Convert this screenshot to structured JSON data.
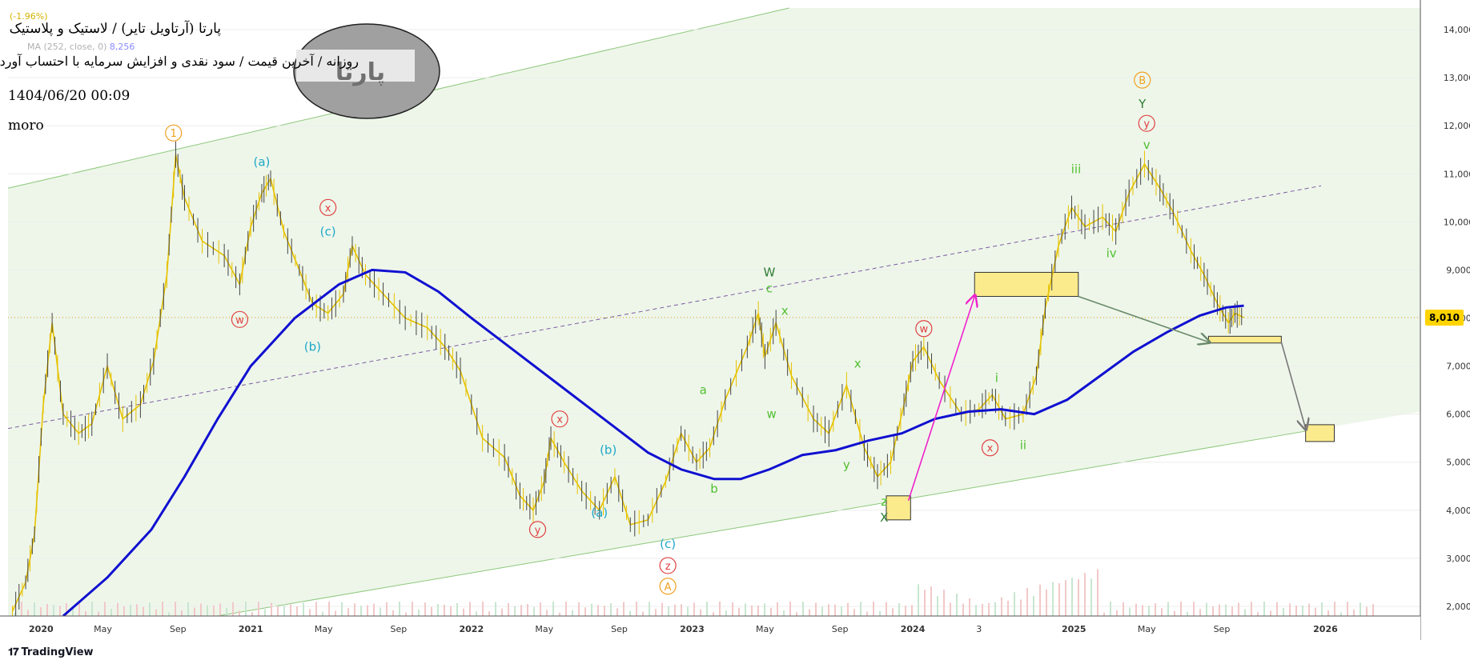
{
  "header": {
    "title": "پارتا (آرتاویل تایر) / لاستیک و پلاستیک",
    "subtitle": "روزانه / آخرین قیمت / سود نقدی و افزایش سرمایه با احتساب آورده",
    "timestamp": "1404/06/20 00:09",
    "author": "moro",
    "legend_change": "(-1.96%)",
    "ma_label": "MA (252, close, 0)",
    "ma_value": "8,256",
    "watermark": "پارتا"
  },
  "footer": {
    "brand": "TradingView"
  },
  "chart_data": {
    "type": "line",
    "x_tick_labels": [
      "2020",
      "May",
      "Sep",
      "2021",
      "May",
      "Sep",
      "2022",
      "May",
      "Sep",
      "2023",
      "May",
      "Sep",
      "2024",
      "3",
      "2025",
      "May",
      "Sep",
      "2026"
    ],
    "y_ticks": [
      "2,000",
      "3,000",
      "4,000",
      "5,000",
      "6,000",
      "7,000",
      "8,000",
      "9,000",
      "10,000",
      "11,000",
      "12,000",
      "13,000",
      "14,000"
    ],
    "ylim": [
      1800,
      14450
    ],
    "last_price": 8010,
    "last_price_label": "8,010",
    "colors": {
      "price": "#e6c200",
      "ma": "#1010d0",
      "channel": "#8cc87a",
      "midline": "#7a5aa0",
      "wave_orange": "#f0a020",
      "wave_red": "#e04040",
      "wave_cyan": "#20a8c8",
      "wave_green": "#50c030",
      "wave_dark": "#2e7d32",
      "arrow_magenta": "#ee22cc"
    },
    "series": [
      {
        "type": "price",
        "points": [
          [
            2019.92,
            1900
          ],
          [
            2019.98,
            2500
          ],
          [
            2020.02,
            3500
          ],
          [
            2020.06,
            6200
          ],
          [
            2020.1,
            7900
          ],
          [
            2020.15,
            6000
          ],
          [
            2020.22,
            5600
          ],
          [
            2020.28,
            5800
          ],
          [
            2020.35,
            7000
          ],
          [
            2020.42,
            5900
          ],
          [
            2020.5,
            6200
          ],
          [
            2020.56,
            7100
          ],
          [
            2020.62,
            8900
          ],
          [
            2020.66,
            11400
          ],
          [
            2020.7,
            10500
          ],
          [
            2020.78,
            9600
          ],
          [
            2020.88,
            9300
          ],
          [
            2020.95,
            8700
          ],
          [
            2021.0,
            9900
          ],
          [
            2021.05,
            10600
          ],
          [
            2021.09,
            10900
          ],
          [
            2021.15,
            9800
          ],
          [
            2021.22,
            9000
          ],
          [
            2021.28,
            8300
          ],
          [
            2021.35,
            8100
          ],
          [
            2021.42,
            8500
          ],
          [
            2021.46,
            9500
          ],
          [
            2021.52,
            8900
          ],
          [
            2021.6,
            8500
          ],
          [
            2021.7,
            8000
          ],
          [
            2021.8,
            7800
          ],
          [
            2021.88,
            7400
          ],
          [
            2021.95,
            6900
          ],
          [
            2022.05,
            5500
          ],
          [
            2022.15,
            5100
          ],
          [
            2022.22,
            4300
          ],
          [
            2022.28,
            4000
          ],
          [
            2022.33,
            4600
          ],
          [
            2022.36,
            5500
          ],
          [
            2022.42,
            5000
          ],
          [
            2022.5,
            4400
          ],
          [
            2022.58,
            4000
          ],
          [
            2022.65,
            4700
          ],
          [
            2022.72,
            3700
          ],
          [
            2022.8,
            3800
          ],
          [
            2022.88,
            4600
          ],
          [
            2022.95,
            5600
          ],
          [
            2023.02,
            5000
          ],
          [
            2023.08,
            5300
          ],
          [
            2023.15,
            6300
          ],
          [
            2023.25,
            7400
          ],
          [
            2023.3,
            8100
          ],
          [
            2023.33,
            7200
          ],
          [
            2023.38,
            7900
          ],
          [
            2023.45,
            6800
          ],
          [
            2023.55,
            5900
          ],
          [
            2023.62,
            5600
          ],
          [
            2023.7,
            6600
          ],
          [
            2023.78,
            5300
          ],
          [
            2023.84,
            4700
          ],
          [
            2023.9,
            5000
          ],
          [
            2023.96,
            6200
          ],
          [
            2024.0,
            7100
          ],
          [
            2024.05,
            7400
          ],
          [
            2024.12,
            6700
          ],
          [
            2024.22,
            6000
          ],
          [
            2024.3,
            6100
          ],
          [
            2024.36,
            6400
          ],
          [
            2024.42,
            5900
          ],
          [
            2024.5,
            6000
          ],
          [
            2024.56,
            6800
          ],
          [
            2024.6,
            8200
          ],
          [
            2024.66,
            9500
          ],
          [
            2024.72,
            10300
          ],
          [
            2024.78,
            9900
          ],
          [
            2024.86,
            10100
          ],
          [
            2024.92,
            9800
          ],
          [
            2024.98,
            10600
          ],
          [
            2025.05,
            11200
          ],
          [
            2025.12,
            10700
          ],
          [
            2025.18,
            10200
          ],
          [
            2025.26,
            9400
          ],
          [
            2025.32,
            8900
          ],
          [
            2025.38,
            8300
          ],
          [
            2025.43,
            7900
          ],
          [
            2025.46,
            8100
          ],
          [
            2025.5,
            8010
          ]
        ]
      },
      {
        "type": "ma",
        "name": "MA (252, close, 0)",
        "points": [
          [
            2020.15,
            1800
          ],
          [
            2020.35,
            2600
          ],
          [
            2020.55,
            3600
          ],
          [
            2020.7,
            4700
          ],
          [
            2020.85,
            5900
          ],
          [
            2021.0,
            7000
          ],
          [
            2021.2,
            8000
          ],
          [
            2021.4,
            8700
          ],
          [
            2021.55,
            9000
          ],
          [
            2021.7,
            8950
          ],
          [
            2021.85,
            8550
          ],
          [
            2022.0,
            8000
          ],
          [
            2022.2,
            7300
          ],
          [
            2022.4,
            6600
          ],
          [
            2022.6,
            5900
          ],
          [
            2022.8,
            5200
          ],
          [
            2022.95,
            4850
          ],
          [
            2023.1,
            4650
          ],
          [
            2023.22,
            4650
          ],
          [
            2023.35,
            4850
          ],
          [
            2023.5,
            5150
          ],
          [
            2023.65,
            5250
          ],
          [
            2023.8,
            5450
          ],
          [
            2023.95,
            5600
          ],
          [
            2024.1,
            5900
          ],
          [
            2024.25,
            6050
          ],
          [
            2024.4,
            6100
          ],
          [
            2024.55,
            6000
          ],
          [
            2024.7,
            6300
          ],
          [
            2024.85,
            6800
          ],
          [
            2025.0,
            7300
          ],
          [
            2025.15,
            7700
          ],
          [
            2025.3,
            8050
          ],
          [
            2025.42,
            8220
          ],
          [
            2025.5,
            8256
          ]
        ]
      }
    ],
    "channel": {
      "upper": [
        [
          2019.9,
          10700
        ],
        [
          2023.44,
          14450
        ]
      ],
      "lower": [
        [
          2020.85,
          1800
        ],
        [
          2025.85,
          5700
        ]
      ],
      "mid": [
        [
          2019.9,
          5700
        ],
        [
          2025.85,
          10750
        ]
      ]
    },
    "zones": [
      {
        "x": [
          2023.88,
          2023.99
        ],
        "y": [
          3800,
          4300
        ]
      },
      {
        "x": [
          2024.28,
          2024.75
        ],
        "y": [
          8450,
          8950
        ]
      },
      {
        "x": [
          2025.34,
          2025.67
        ],
        "y": [
          7480,
          7620
        ]
      },
      {
        "x": [
          2025.78,
          2025.91
        ],
        "y": [
          5430,
          5780
        ]
      }
    ],
    "arrows": [
      {
        "color": "#ee22cc",
        "from": [
          2023.98,
          4200
        ],
        "to": [
          2024.28,
          8450
        ]
      },
      {
        "color": "#6a8a6a",
        "from": [
          2024.75,
          8450
        ],
        "to": [
          2025.34,
          7500
        ]
      },
      {
        "color": "#777777",
        "from": [
          2025.67,
          7500
        ],
        "to": [
          2025.78,
          5700
        ]
      }
    ],
    "wave_labels": [
      {
        "text": "1",
        "x": 2020.65,
        "y": 11850,
        "color": "#f0a020",
        "circle": true
      },
      {
        "text": "(a)",
        "x": 2021.05,
        "y": 11250,
        "color": "#20a8c8",
        "circle": false
      },
      {
        "text": "x",
        "x": 2021.35,
        "y": 10300,
        "color": "#e04040",
        "circle": true
      },
      {
        "text": "(c)",
        "x": 2021.35,
        "y": 9800,
        "color": "#20a8c8",
        "circle": false
      },
      {
        "text": "w",
        "x": 2020.95,
        "y": 7970,
        "color": "#e04040",
        "circle": true
      },
      {
        "text": "(b)",
        "x": 2021.28,
        "y": 7400,
        "color": "#20a8c8",
        "circle": false
      },
      {
        "text": "x",
        "x": 2022.4,
        "y": 5900,
        "color": "#e04040",
        "circle": true
      },
      {
        "text": "y",
        "x": 2022.3,
        "y": 3600,
        "color": "#e04040",
        "circle": true
      },
      {
        "text": "(b)",
        "x": 2022.62,
        "y": 5250,
        "color": "#20a8c8",
        "circle": false
      },
      {
        "text": "(a)",
        "x": 2022.58,
        "y": 3950,
        "color": "#20a8c8",
        "circle": false
      },
      {
        "text": "(c)",
        "x": 2022.89,
        "y": 3300,
        "color": "#20a8c8",
        "circle": false
      },
      {
        "text": "z",
        "x": 2022.89,
        "y": 2850,
        "color": "#e04040",
        "circle": true
      },
      {
        "text": "A",
        "x": 2022.89,
        "y": 2420,
        "color": "#f0a020",
        "circle": true
      },
      {
        "text": "a",
        "x": 2023.05,
        "y": 6500,
        "color": "#50c030",
        "circle": false
      },
      {
        "text": "b",
        "x": 2023.1,
        "y": 4450,
        "color": "#50c030",
        "circle": false
      },
      {
        "text": "W",
        "x": 2023.35,
        "y": 8950,
        "color": "#2e7d32",
        "circle": false
      },
      {
        "text": "c",
        "x": 2023.35,
        "y": 8620,
        "color": "#50c030",
        "circle": false
      },
      {
        "text": "x",
        "x": 2023.42,
        "y": 8150,
        "color": "#50c030",
        "circle": false
      },
      {
        "text": "w",
        "x": 2023.36,
        "y": 6000,
        "color": "#50c030",
        "circle": false
      },
      {
        "text": "x",
        "x": 2023.75,
        "y": 7050,
        "color": "#50c030",
        "circle": false
      },
      {
        "text": "y",
        "x": 2023.7,
        "y": 4950,
        "color": "#50c030",
        "circle": false
      },
      {
        "text": "z",
        "x": 2023.87,
        "y": 4180,
        "color": "#50c030",
        "circle": false
      },
      {
        "text": "X",
        "x": 2023.87,
        "y": 3850,
        "color": "#2e7d32",
        "circle": false
      },
      {
        "text": "w",
        "x": 2024.05,
        "y": 7780,
        "color": "#e04040",
        "circle": true
      },
      {
        "text": "i",
        "x": 2024.38,
        "y": 6750,
        "color": "#50c030",
        "circle": false
      },
      {
        "text": "x",
        "x": 2024.35,
        "y": 5300,
        "color": "#e04040",
        "circle": true
      },
      {
        "text": "ii",
        "x": 2024.5,
        "y": 5350,
        "color": "#50c030",
        "circle": false
      },
      {
        "text": "iii",
        "x": 2024.74,
        "y": 11100,
        "color": "#50c030",
        "circle": false
      },
      {
        "text": "iv",
        "x": 2024.9,
        "y": 9350,
        "color": "#50c030",
        "circle": false
      },
      {
        "text": "B",
        "x": 2025.04,
        "y": 12950,
        "color": "#f0a020",
        "circle": true
      },
      {
        "text": "Y",
        "x": 2025.04,
        "y": 12450,
        "color": "#2e7d32",
        "circle": false
      },
      {
        "text": "y",
        "x": 2025.06,
        "y": 12050,
        "color": "#e04040",
        "circle": true
      },
      {
        "text": "v",
        "x": 2025.06,
        "y": 11600,
        "color": "#50c030",
        "circle": false
      }
    ]
  }
}
